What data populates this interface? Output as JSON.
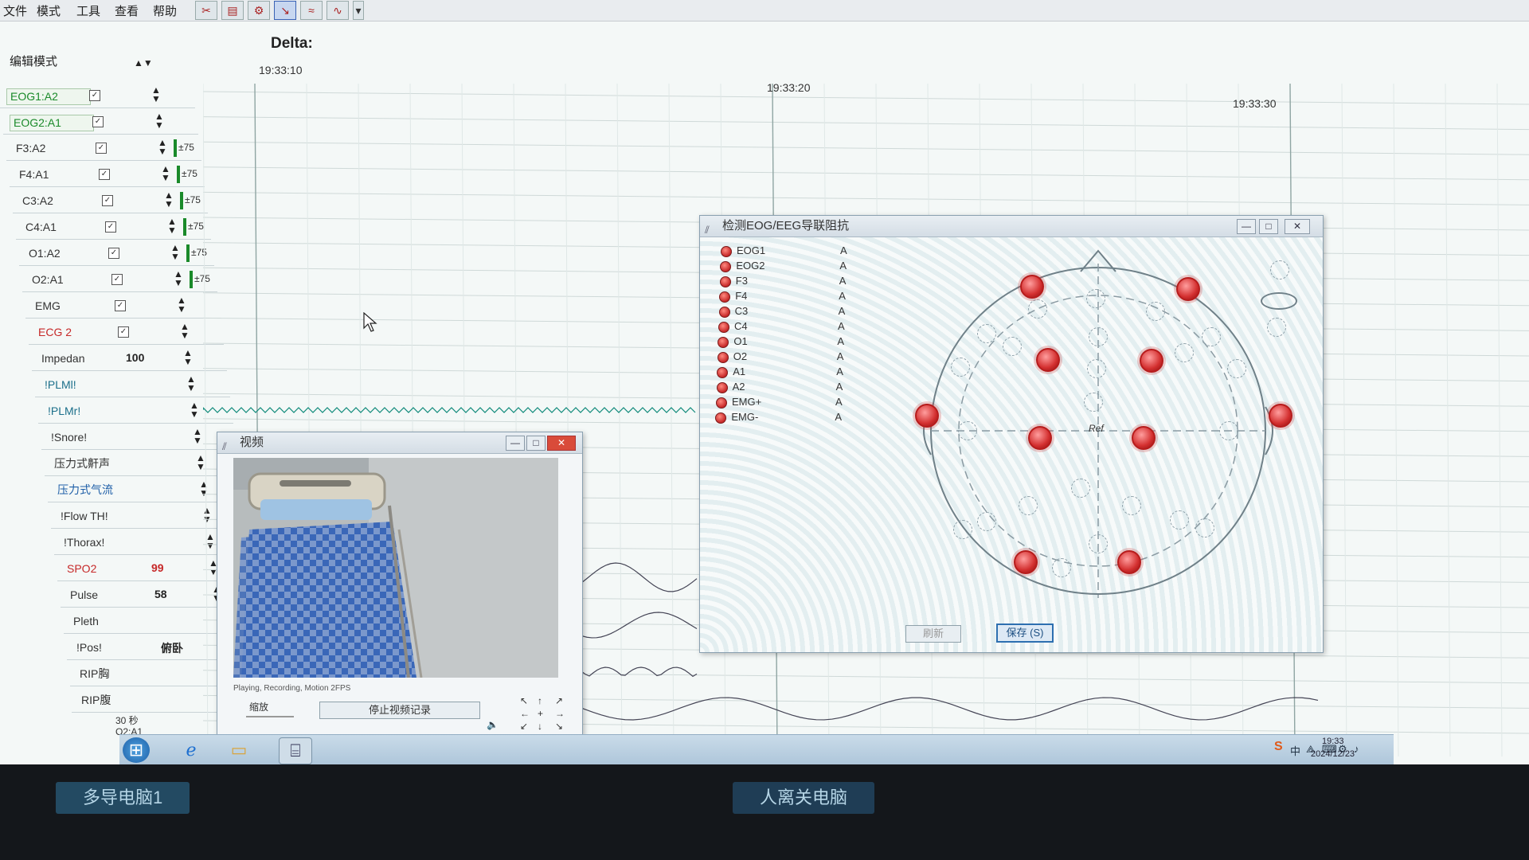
{
  "menubar": {
    "items": [
      "文件",
      "模式",
      "工具",
      "查看",
      "帮助"
    ],
    "toolbar_icons": [
      "montage-icon",
      "report-icon",
      "tools-icon",
      "marker-icon",
      "wave-icon",
      "trend-icon"
    ]
  },
  "header": {
    "edit_mode": "编辑模式",
    "filter_label": "Delta:",
    "times": [
      "19:33:10",
      "19:33:20",
      "19:33:30"
    ]
  },
  "channels": [
    {
      "name": "EOG1:A2",
      "checked": true,
      "style": "green"
    },
    {
      "name": "EOG2:A1",
      "checked": true,
      "style": "green"
    },
    {
      "name": "F3:A2",
      "checked": true,
      "style": "plain",
      "scale": "±75"
    },
    {
      "name": "F4:A1",
      "checked": true,
      "style": "plain",
      "scale": "±75"
    },
    {
      "name": "C3:A2",
      "checked": true,
      "style": "plain",
      "scale": "±75"
    },
    {
      "name": "C4:A1",
      "checked": true,
      "style": "plain",
      "scale": "±75"
    },
    {
      "name": "O1:A2",
      "checked": true,
      "style": "plain",
      "scale": "±75"
    },
    {
      "name": "O2:A1",
      "checked": true,
      "style": "plain",
      "scale": "±75"
    },
    {
      "name": "EMG",
      "checked": true,
      "style": "plain"
    },
    {
      "name": "ECG 2",
      "checked": true,
      "style": "red"
    },
    {
      "name": "Impedan",
      "value": "100",
      "style": "plain"
    },
    {
      "name": "!PLMl!",
      "style": "teal"
    },
    {
      "name": "!PLMr!",
      "style": "teal"
    },
    {
      "name": "!Snore!",
      "style": "plain"
    },
    {
      "name": "压力式鼾声",
      "style": "plain"
    },
    {
      "name": "压力式气流",
      "style": "blue"
    },
    {
      "name": "!Flow TH!",
      "style": "plain"
    },
    {
      "name": "!Thorax!",
      "style": "plain"
    },
    {
      "name": "SPO2",
      "value": "99",
      "style": "red"
    },
    {
      "name": "Pulse",
      "value": "58",
      "style": "plain"
    },
    {
      "name": "Pleth",
      "style": "plain"
    },
    {
      "name": "!Pos!",
      "value": "俯卧",
      "style": "plain"
    },
    {
      "name": "RIP胸",
      "style": "plain"
    },
    {
      "name": "RIP腹",
      "style": "plain"
    }
  ],
  "footer_labels": [
    "30 秒",
    "O2:A1"
  ],
  "video_window": {
    "title": "视频",
    "status": "Playing, Recording, Motion 2FPS",
    "zoom_label": "缩放",
    "stop_button": "停止视频记录",
    "nav_arrows": [
      "↖",
      "↑",
      "↗",
      "←",
      "+",
      "→",
      "↙",
      "↓",
      "↘"
    ]
  },
  "impedance_window": {
    "title": "检测EOG/EEG导联阻抗",
    "leads": [
      {
        "name": "EOG1",
        "status": "A"
      },
      {
        "name": "EOG2",
        "status": "A"
      },
      {
        "name": "F3",
        "status": "A"
      },
      {
        "name": "F4",
        "status": "A"
      },
      {
        "name": "C3",
        "status": "A"
      },
      {
        "name": "C4",
        "status": "A"
      },
      {
        "name": "O1",
        "status": "A"
      },
      {
        "name": "O2",
        "status": "A"
      },
      {
        "name": "A1",
        "status": "A"
      },
      {
        "name": "A2",
        "status": "A"
      },
      {
        "name": "EMG+",
        "status": "A"
      },
      {
        "name": "EMG-",
        "status": "A"
      }
    ],
    "ref_label": "Ref",
    "refresh_button": "刷新",
    "save_button": "保存 (S)"
  },
  "taskbar": {
    "clock_time": "19:33",
    "clock_date": "2024/12/23"
  },
  "bezel": {
    "left_label": "多导电脑1",
    "center_label": "人离关电脑"
  },
  "colors": {
    "eeg_trace": "#0f8a7a",
    "grid": "#cfd9d8",
    "electrode": "#d32f2f",
    "accent": "#2d6fb0"
  }
}
